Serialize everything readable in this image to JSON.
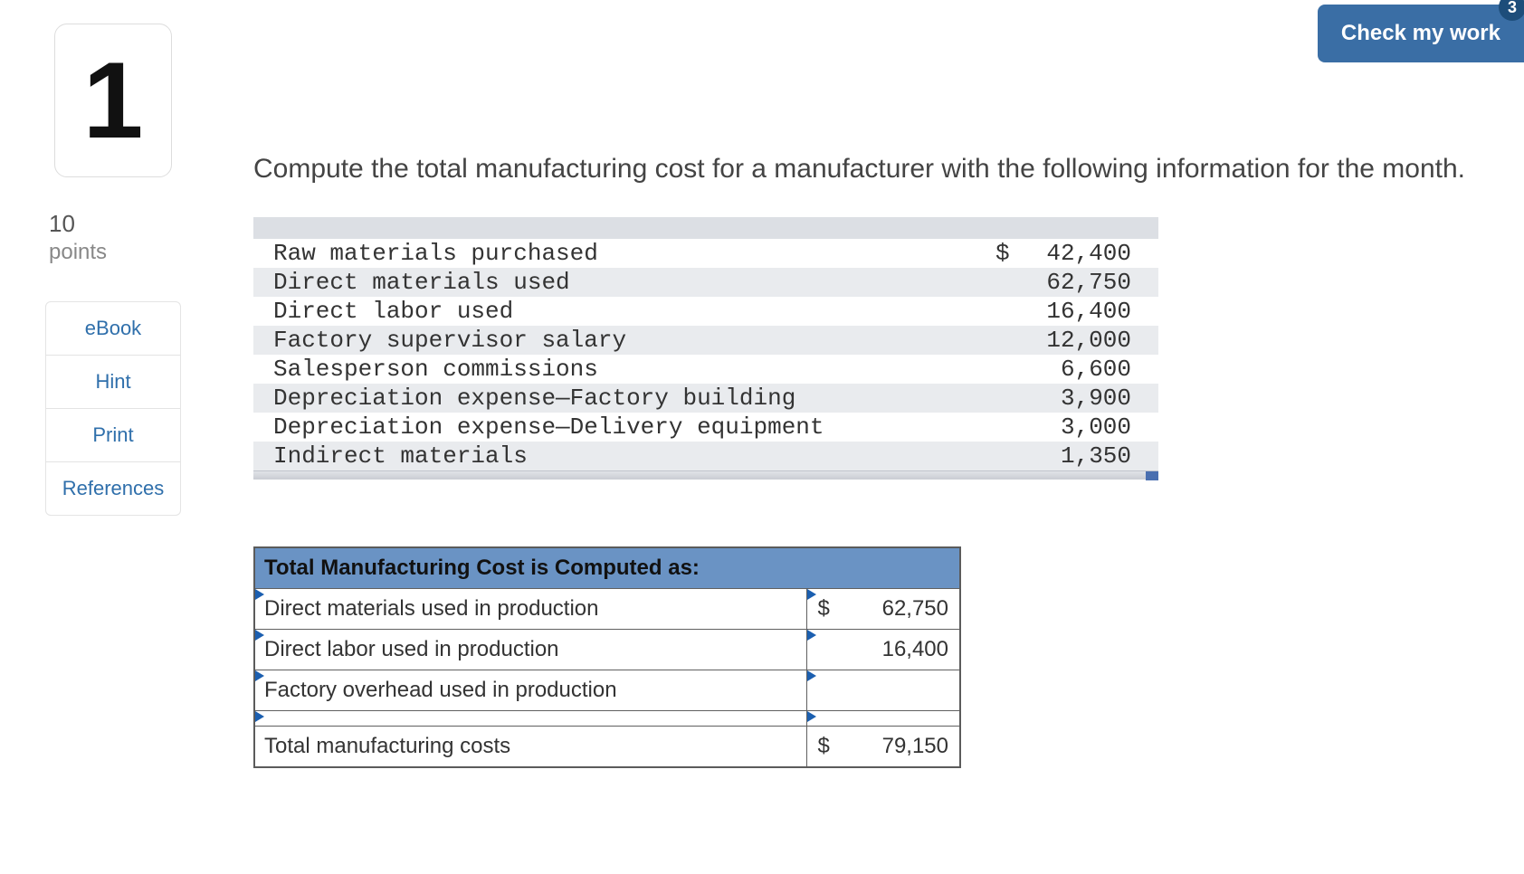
{
  "badge_count": "3",
  "check_my_work_label": "Check my work",
  "question_number": "1",
  "points_value": "10",
  "points_label": "points",
  "side_links": {
    "ebook": "eBook",
    "hint": "Hint",
    "print": "Print",
    "references": "References"
  },
  "prompt": "Compute the total manufacturing cost for a manufacturer with the following information for the month.",
  "info_rows": [
    {
      "label": "Raw materials purchased",
      "currency": "$",
      "value": "42,400"
    },
    {
      "label": "Direct materials used",
      "currency": "",
      "value": "62,750"
    },
    {
      "label": "Direct labor used",
      "currency": "",
      "value": "16,400"
    },
    {
      "label": "Factory supervisor salary",
      "currency": "",
      "value": "12,000"
    },
    {
      "label": "Salesperson commissions",
      "currency": "",
      "value": "6,600"
    },
    {
      "label": "Depreciation expense—Factory building",
      "currency": "",
      "value": "3,900"
    },
    {
      "label": "Depreciation expense—Delivery equipment",
      "currency": "",
      "value": "3,000"
    },
    {
      "label": "Indirect materials",
      "currency": "",
      "value": "1,350"
    }
  ],
  "answer": {
    "header": "Total Manufacturing Cost is Computed as:",
    "rows": [
      {
        "label": "Direct materials used in production",
        "dollar": "$",
        "value": "62,750",
        "label_marker": true,
        "val_marker": true
      },
      {
        "label": "Direct labor used in production",
        "dollar": "",
        "value": "16,400",
        "label_marker": true,
        "val_marker": true
      },
      {
        "label": "Factory overhead used in production",
        "dollar": "",
        "value": "",
        "label_marker": true,
        "val_marker": true
      },
      {
        "label": "",
        "dollar": "",
        "value": "",
        "label_marker": true,
        "val_marker": true
      }
    ],
    "total_label": "Total manufacturing costs",
    "total_dollar": "$",
    "total_value": "79,150"
  }
}
